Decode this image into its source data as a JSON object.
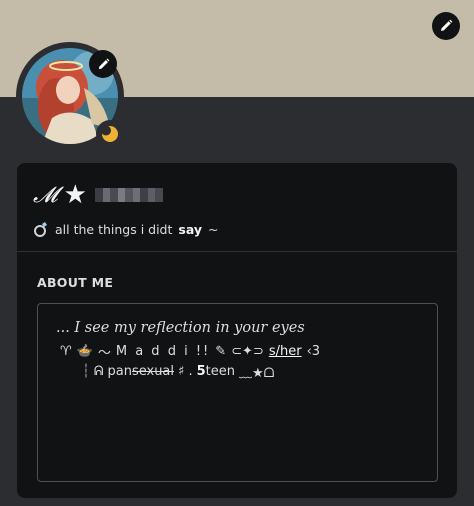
{
  "colors": {
    "banner": "#c4bba9",
    "background": "#2b2d31",
    "card": "#111214",
    "status_idle": "#f0b232"
  },
  "icons": {
    "banner_edit": "pencil-icon",
    "avatar_edit": "pencil-icon",
    "status": "moon-icon",
    "custom_status_emoji": "ring-icon"
  },
  "profile": {
    "name_script": "𝓜",
    "name_star": "★",
    "name_redacted": "pixelated",
    "custom_status": "all the things i didt",
    "custom_status_bold": "say",
    "custom_status_tail": "~"
  },
  "about": {
    "title": "ABOUT ME",
    "line1": "... I see my reflection in your eyes",
    "line2": {
      "glyph_a": "♈",
      "emoji": "🍲",
      "wave": "〜",
      "name": "M a d d i !!",
      "pen": "✎",
      "sparkle": "⊂✦⊃",
      "pronouns": "s/her",
      "heart": "‹3"
    },
    "line3": {
      "bar": "┆",
      "hook": "ᕱ",
      "pan": "pan",
      "sexual": "sexual",
      "hash": "♯ .",
      "five": "5",
      "teen": "teen",
      "tail": "﹏★ᗝ"
    }
  }
}
